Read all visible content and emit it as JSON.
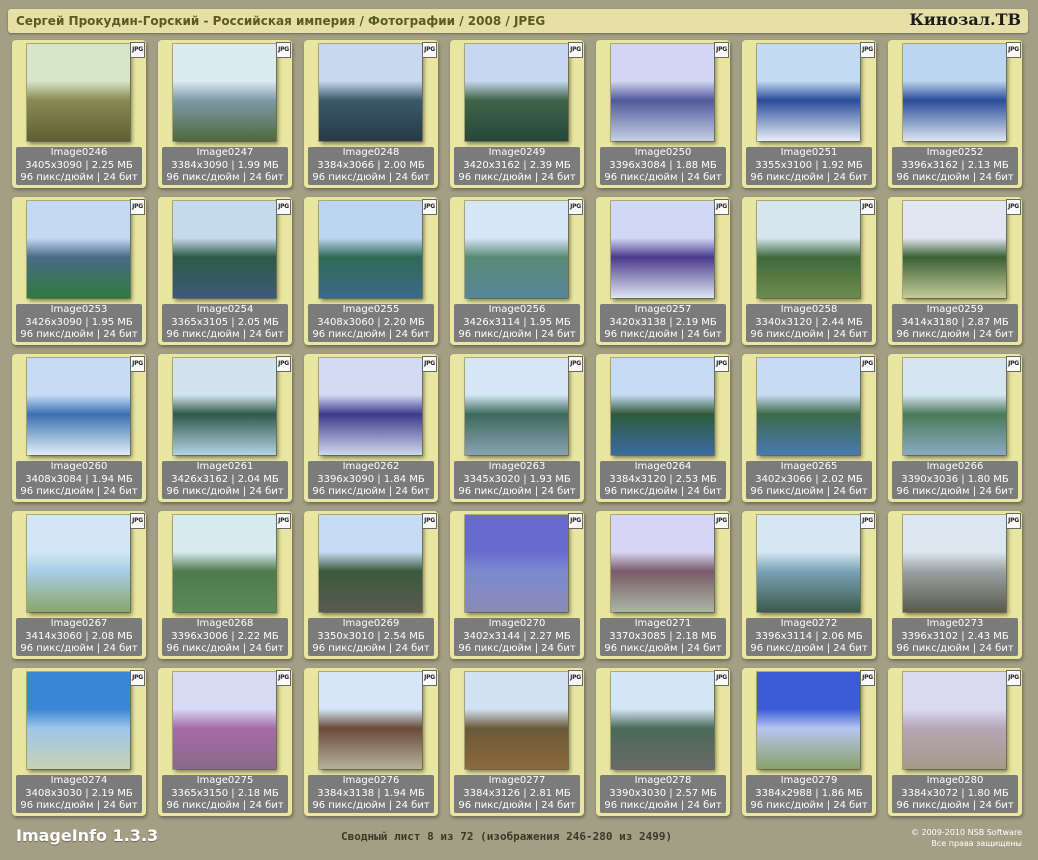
{
  "header": {
    "title": "Сергей Прокудин-Горский - Российская империя / Фотографии / 2008 / JPEG",
    "brand": "Кинозал.ТВ"
  },
  "file_badge": "JPG",
  "thumbnails": [
    {
      "name": "Image0246",
      "dims": "3405x3090 | 2.25 МБ",
      "meta": "96 пикс/дюйм | 24 бит",
      "colors": [
        "#d7e6c8",
        "#8a8a52",
        "#5c6034"
      ]
    },
    {
      "name": "Image0247",
      "dims": "3384x3090 | 1.99 МБ",
      "meta": "96 пикс/дюйм | 24 бит",
      "colors": [
        "#dceaf2",
        "#7f9aa8",
        "#4d6a3c"
      ]
    },
    {
      "name": "Image0248",
      "dims": "3384x3066 | 2.00 МБ",
      "meta": "96 пикс/дюйм | 24 бит",
      "colors": [
        "#c8d8ee",
        "#3a5a6a",
        "#283a46"
      ]
    },
    {
      "name": "Image0249",
      "dims": "3420x3162 | 2.39 МБ",
      "meta": "96 пикс/дюйм | 24 бит",
      "colors": [
        "#c6d8f0",
        "#3e6448",
        "#27473a"
      ]
    },
    {
      "name": "Image0250",
      "dims": "3396x3084 | 1.88 МБ",
      "meta": "96 пикс/дюйм | 24 бит",
      "colors": [
        "#d2d6f2",
        "#505a9a",
        "#c6d0e6"
      ]
    },
    {
      "name": "Image0251",
      "dims": "3355x3100 | 1.92 МБ",
      "meta": "96 пикс/дюйм | 24 бит",
      "colors": [
        "#c2daf2",
        "#2a4c9a",
        "#e6eef6"
      ]
    },
    {
      "name": "Image0252",
      "dims": "3396x3162 | 2.13 МБ",
      "meta": "96 пикс/дюйм | 24 бит",
      "colors": [
        "#bcd6f0",
        "#2a4c9a",
        "#dce6f0"
      ]
    },
    {
      "name": "Image0253",
      "dims": "3426x3090 | 1.95 МБ",
      "meta": "96 пикс/дюйм | 24 бит",
      "colors": [
        "#c4daf2",
        "#4a6a86",
        "#2f7a3e"
      ]
    },
    {
      "name": "Image0254",
      "dims": "3365x3105 | 2.05 МБ",
      "meta": "96 пикс/дюйм | 24 бит",
      "colors": [
        "#c6daee",
        "#2c5a46",
        "#3c5a7a"
      ]
    },
    {
      "name": "Image0255",
      "dims": "3408x3060 | 2.20 МБ",
      "meta": "96 пикс/дюйм | 24 бит",
      "colors": [
        "#bcd6f2",
        "#2e6a56",
        "#3a6a8a"
      ]
    },
    {
      "name": "Image0256",
      "dims": "3426x3114 | 1.95 МБ",
      "meta": "96 пикс/дюйм | 24 бит",
      "colors": [
        "#d6e6f6",
        "#5a8a76",
        "#56869a"
      ]
    },
    {
      "name": "Image0257",
      "dims": "3420x3138 | 2.19 МБ",
      "meta": "96 пикс/дюйм | 24 бит",
      "colors": [
        "#d0d8f4",
        "#4c3a8a",
        "#dfe6f4"
      ]
    },
    {
      "name": "Image0258",
      "dims": "3340x3120 | 2.44 МБ",
      "meta": "96 пикс/дюйм | 24 бит",
      "colors": [
        "#d6e6ee",
        "#3f6a3e",
        "#6c8c4c"
      ]
    },
    {
      "name": "Image0259",
      "dims": "3414x3180 | 2.87 МБ",
      "meta": "96 пикс/дюйм | 24 бит",
      "colors": [
        "#e2e6f2",
        "#3a6034",
        "#c6cc9a"
      ]
    },
    {
      "name": "Image0260",
      "dims": "3408x3084 | 1.94 МБ",
      "meta": "96 пикс/дюйм | 24 бит",
      "colors": [
        "#c6dcf4",
        "#3a70b2",
        "#e2eef6"
      ]
    },
    {
      "name": "Image0261",
      "dims": "3426x3162 | 2.04 МБ",
      "meta": "96 пикс/дюйм | 24 бит",
      "colors": [
        "#d2e2ee",
        "#2e5a4a",
        "#b6d2e6"
      ]
    },
    {
      "name": "Image0262",
      "dims": "3396x3090 | 1.84 МБ",
      "meta": "96 пикс/дюйм | 24 бит",
      "colors": [
        "#d2daf4",
        "#3c3a8a",
        "#cfd8ee"
      ]
    },
    {
      "name": "Image0263",
      "dims": "3345x3020 | 1.93 МБ",
      "meta": "96 пикс/дюйм | 24 бит",
      "colors": [
        "#d6e6f4",
        "#3c6a5a",
        "#8aa2b2"
      ]
    },
    {
      "name": "Image0264",
      "dims": "3384x3120 | 2.53 МБ",
      "meta": "96 пикс/дюйм | 24 бит",
      "colors": [
        "#c6daf2",
        "#2f5a3a",
        "#3a6aa2"
      ]
    },
    {
      "name": "Image0265",
      "dims": "3402x3066 | 2.02 МБ",
      "meta": "96 пикс/дюйм | 24 бит",
      "colors": [
        "#c6dcf2",
        "#3c6a4a",
        "#4a7ab2"
      ]
    },
    {
      "name": "Image0266",
      "dims": "3390x3036 | 1.80 МБ",
      "meta": "96 пикс/дюйм | 24 бит",
      "colors": [
        "#d6e6f0",
        "#4a7a5a",
        "#8aaac2"
      ]
    },
    {
      "name": "Image0267",
      "dims": "3414x3060 | 2.08 МБ",
      "meta": "96 пикс/дюйм | 24 бит",
      "colors": [
        "#d2e6f6",
        "#a6cee6",
        "#8aa66a"
      ]
    },
    {
      "name": "Image0268",
      "dims": "3396x3006 | 2.22 МБ",
      "meta": "96 пикс/дюйм | 24 бит",
      "colors": [
        "#d6eaf0",
        "#4e7a4e",
        "#5a8a5a"
      ]
    },
    {
      "name": "Image0269",
      "dims": "3350x3010 | 2.54 МБ",
      "meta": "96 пикс/дюйм | 24 бит",
      "colors": [
        "#c6dcf4",
        "#3a5a3a",
        "#5a5a52"
      ]
    },
    {
      "name": "Image0270",
      "dims": "3402x3144 | 2.27 МБ",
      "meta": "96 пикс/дюйм | 24 бит",
      "colors": [
        "#6a6ace",
        "#7a8ace",
        "#8a8ab6"
      ]
    },
    {
      "name": "Image0271",
      "dims": "3370x3085 | 2.18 МБ",
      "meta": "96 пикс/дюйм | 24 бит",
      "colors": [
        "#d6d6f4",
        "#7a5a6a",
        "#aab6a2"
      ]
    },
    {
      "name": "Image0272",
      "dims": "3396x3114 | 2.06 МБ",
      "meta": "96 пикс/дюйм | 24 бит",
      "colors": [
        "#d6e6f2",
        "#7aa2b6",
        "#3c5a4a"
      ]
    },
    {
      "name": "Image0273",
      "dims": "3396x3102 | 2.43 МБ",
      "meta": "96 пикс/дюйм | 24 бит",
      "colors": [
        "#dce6f0",
        "#9aa2a2",
        "#5a5a4a"
      ]
    },
    {
      "name": "Image0274",
      "dims": "3408x3030 | 2.19 МБ",
      "meta": "96 пикс/дюйм | 24 бит",
      "colors": [
        "#3a86d6",
        "#9ec6ea",
        "#c6d2b2"
      ]
    },
    {
      "name": "Image0275",
      "dims": "3365x3150 | 2.18 МБ",
      "meta": "96 пикс/дюйм | 24 бит",
      "colors": [
        "#d6daf2",
        "#a66aa6",
        "#8a6a8a"
      ]
    },
    {
      "name": "Image0276",
      "dims": "3384x3138 | 1.94 МБ",
      "meta": "96 пикс/дюйм | 24 бит",
      "colors": [
        "#d6e6f6",
        "#6a4a3a",
        "#b6b29a"
      ]
    },
    {
      "name": "Image0277",
      "dims": "3384x3126 | 2.81 МБ",
      "meta": "96 пикс/дюйм | 24 бит",
      "colors": [
        "#d2e2f2",
        "#6a5a3a",
        "#8a6a3a"
      ]
    },
    {
      "name": "Image0278",
      "dims": "3390x3030 | 2.57 МБ",
      "meta": "96 пикс/дюйм | 24 бит",
      "colors": [
        "#d2e6f4",
        "#4a6a5a",
        "#6a6a6a"
      ]
    },
    {
      "name": "Image0279",
      "dims": "3384x2988 | 1.86 МБ",
      "meta": "96 пикс/дюйм | 24 бит",
      "colors": [
        "#3a5ad6",
        "#b6c6ee",
        "#8aa26a"
      ]
    },
    {
      "name": "Image0280",
      "dims": "3384x3072 | 1.80 МБ",
      "meta": "96 пикс/дюйм | 24 бит",
      "colors": [
        "#dadaee",
        "#b6a6b6",
        "#a69a8a"
      ]
    }
  ],
  "footer": {
    "app_name": "ImageInfo 1.3.3",
    "summary": "Сводный лист 8 из 72 (изображения 246-280 из 2499)",
    "copyright_line1": "© 2009-2010 NSB Software",
    "copyright_line2": "Все права защищены"
  }
}
